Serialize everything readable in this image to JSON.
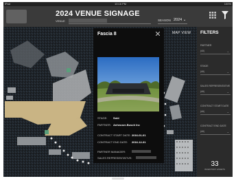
{
  "status_bar": {
    "left": "iPad",
    "time": "10:16 PM",
    "right": "100%"
  },
  "header": {
    "title": "2024 VENUE SIGNAGE",
    "venue_label": "VENUE",
    "season_label": "SEASON",
    "season_value": "2024",
    "season_chevron": "⌄"
  },
  "map": {
    "map_view_label": "MAP VIEW"
  },
  "popup": {
    "title": "Fascia 8",
    "details": {
      "stage_label": "STAGE:",
      "stage_value": "Sold",
      "partner_label": "PARTNER:",
      "partner_value": "Anheuser-Busch Inc",
      "contract_start_label": "CONTRACT START DATE:",
      "contract_start_value": "2016-01-01",
      "contract_end_label": "CONTRACT END DATE:",
      "contract_end_value": "2016-12-31",
      "partner_manager_label": "PARTNER MANAGER:",
      "sales_rep_label": "SALES REPRESENTATIVE:"
    }
  },
  "sidebar": {
    "title": "FILTERS",
    "filters": [
      {
        "label": "PARTNER",
        "value": "(All)"
      },
      {
        "label": "STAGE",
        "value": "(All)"
      },
      {
        "label": "SALES REPRESENTATIVE",
        "value": "(All)"
      },
      {
        "label": "CONTRACT START DATE",
        "value": "(All)"
      },
      {
        "label": "CONTRACT END DATE",
        "value": "(All)"
      }
    ],
    "count": "33",
    "count_label": "INVENTORY ASSETS"
  },
  "colors": {
    "app_bg": "#2b2b2b",
    "header_bg": "#3a3a3a",
    "popup_bg": "#0d0d0d",
    "field_accent": "#c9b484",
    "seat_green": "#5a9e7b"
  }
}
